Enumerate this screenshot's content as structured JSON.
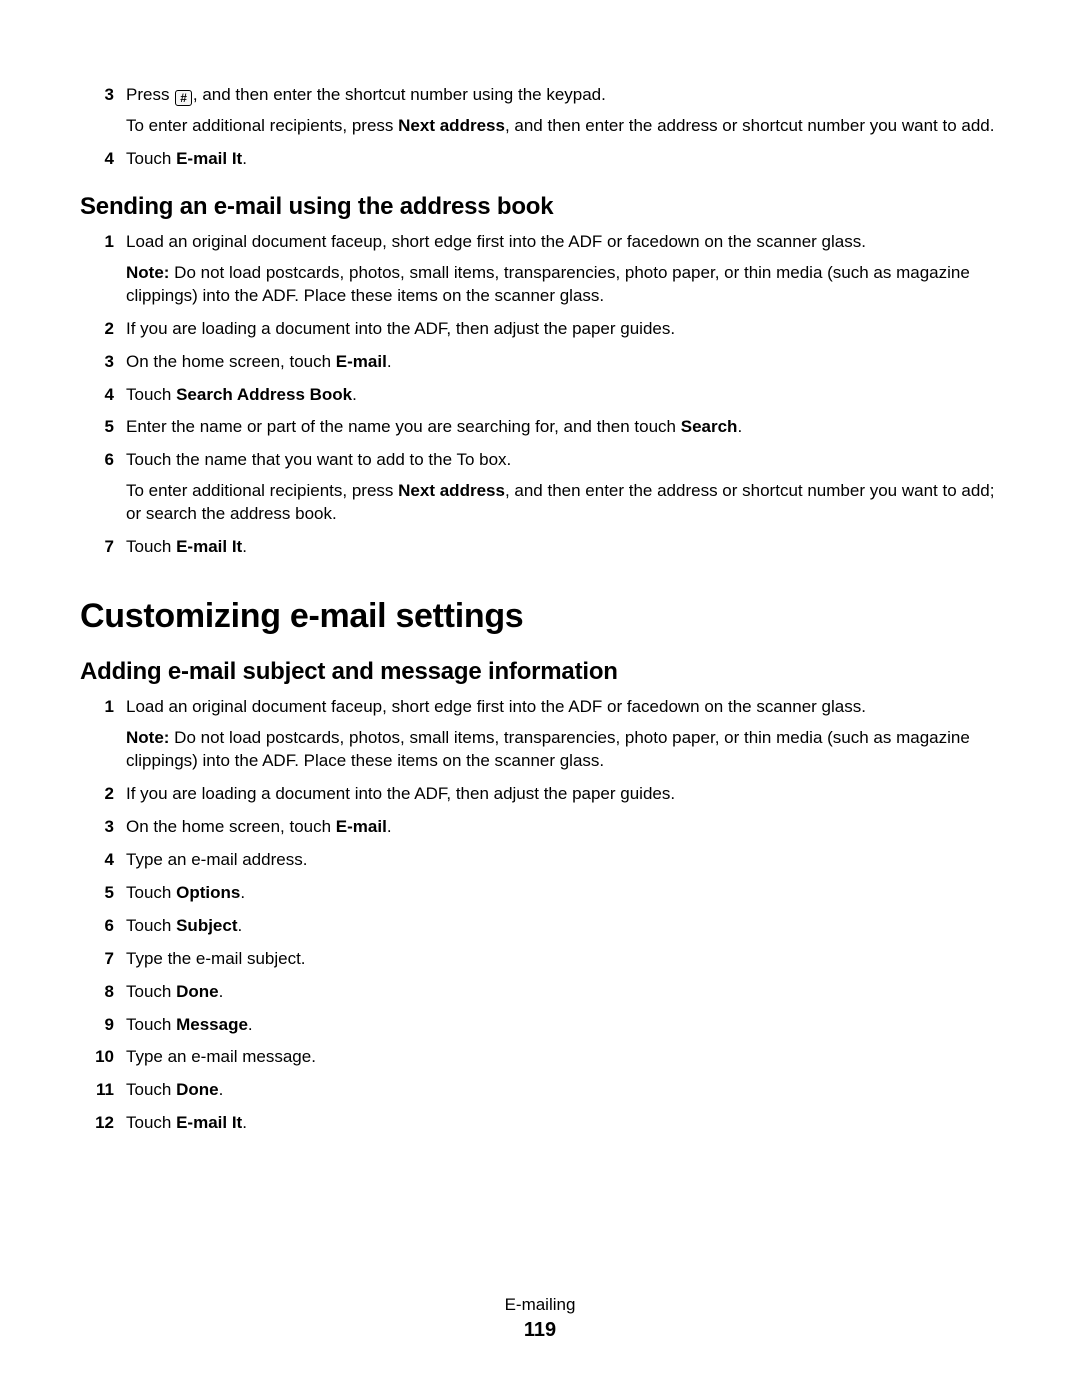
{
  "continuation_list": [
    {
      "num": "3",
      "paras": [
        {
          "runs": [
            {
              "t": "Press "
            },
            {
              "icon": "hash"
            },
            {
              "t": ", and then enter the shortcut number using the keypad."
            }
          ]
        },
        {
          "runs": [
            {
              "t": "To enter additional recipients, press "
            },
            {
              "t": "Next address",
              "bold": true
            },
            {
              "t": ", and then enter the address or shortcut number you want to add."
            }
          ]
        }
      ]
    },
    {
      "num": "4",
      "paras": [
        {
          "runs": [
            {
              "t": "Touch "
            },
            {
              "t": "E-mail It",
              "bold": true
            },
            {
              "t": "."
            }
          ]
        }
      ]
    }
  ],
  "subsection_a_title": "Sending an e-mail using the address book",
  "subsection_a_list": [
    {
      "num": "1",
      "paras": [
        {
          "runs": [
            {
              "t": "Load an original document faceup, short edge first into the ADF or facedown on the scanner glass."
            }
          ]
        },
        {
          "runs": [
            {
              "t": "Note: ",
              "bold": true
            },
            {
              "t": "Do not load postcards, photos, small items, transparencies, photo paper, or thin media (such as magazine clippings) into the ADF. Place these items on the scanner glass."
            }
          ]
        }
      ]
    },
    {
      "num": "2",
      "paras": [
        {
          "runs": [
            {
              "t": "If you are loading a document into the ADF, then adjust the paper guides."
            }
          ]
        }
      ]
    },
    {
      "num": "3",
      "paras": [
        {
          "runs": [
            {
              "t": "On the home screen, touch "
            },
            {
              "t": "E-mail",
              "bold": true
            },
            {
              "t": "."
            }
          ]
        }
      ]
    },
    {
      "num": "4",
      "paras": [
        {
          "runs": [
            {
              "t": "Touch "
            },
            {
              "t": "Search Address Book",
              "bold": true
            },
            {
              "t": "."
            }
          ]
        }
      ]
    },
    {
      "num": "5",
      "paras": [
        {
          "runs": [
            {
              "t": "Enter the name or part of the name you are searching for, and then touch "
            },
            {
              "t": "Search",
              "bold": true
            },
            {
              "t": "."
            }
          ]
        }
      ]
    },
    {
      "num": "6",
      "paras": [
        {
          "runs": [
            {
              "t": "Touch the name that you want to add to the To box."
            }
          ]
        },
        {
          "runs": [
            {
              "t": "To enter additional recipients, press "
            },
            {
              "t": "Next address",
              "bold": true
            },
            {
              "t": ", and then enter the address or shortcut number you want to add; or search the address book."
            }
          ]
        }
      ]
    },
    {
      "num": "7",
      "paras": [
        {
          "runs": [
            {
              "t": "Touch "
            },
            {
              "t": "E-mail It",
              "bold": true
            },
            {
              "t": "."
            }
          ]
        }
      ]
    }
  ],
  "section_title": "Customizing e-mail settings",
  "subsection_b_title": "Adding e-mail subject and message information",
  "subsection_b_list": [
    {
      "num": "1",
      "paras": [
        {
          "runs": [
            {
              "t": "Load an original document faceup, short edge first into the ADF or facedown on the scanner glass."
            }
          ]
        },
        {
          "runs": [
            {
              "t": "Note: ",
              "bold": true
            },
            {
              "t": "Do not load postcards, photos, small items, transparencies, photo paper, or thin media (such as magazine clippings) into the ADF. Place these items on the scanner glass."
            }
          ]
        }
      ]
    },
    {
      "num": "2",
      "paras": [
        {
          "runs": [
            {
              "t": "If you are loading a document into the ADF, then adjust the paper guides."
            }
          ]
        }
      ]
    },
    {
      "num": "3",
      "paras": [
        {
          "runs": [
            {
              "t": "On the home screen, touch "
            },
            {
              "t": "E-mail",
              "bold": true
            },
            {
              "t": "."
            }
          ]
        }
      ]
    },
    {
      "num": "4",
      "paras": [
        {
          "runs": [
            {
              "t": "Type an e-mail address."
            }
          ]
        }
      ]
    },
    {
      "num": "5",
      "paras": [
        {
          "runs": [
            {
              "t": "Touch "
            },
            {
              "t": "Options",
              "bold": true
            },
            {
              "t": "."
            }
          ]
        }
      ]
    },
    {
      "num": "6",
      "paras": [
        {
          "runs": [
            {
              "t": "Touch "
            },
            {
              "t": "Subject",
              "bold": true
            },
            {
              "t": "."
            }
          ]
        }
      ]
    },
    {
      "num": "7",
      "paras": [
        {
          "runs": [
            {
              "t": "Type the e-mail subject."
            }
          ]
        }
      ]
    },
    {
      "num": "8",
      "paras": [
        {
          "runs": [
            {
              "t": "Touch "
            },
            {
              "t": "Done",
              "bold": true
            },
            {
              "t": "."
            }
          ]
        }
      ]
    },
    {
      "num": "9",
      "paras": [
        {
          "runs": [
            {
              "t": "Touch "
            },
            {
              "t": "Message",
              "bold": true
            },
            {
              "t": "."
            }
          ]
        }
      ]
    },
    {
      "num": "10",
      "paras": [
        {
          "runs": [
            {
              "t": "Type an e-mail message."
            }
          ]
        }
      ]
    },
    {
      "num": "11",
      "paras": [
        {
          "runs": [
            {
              "t": "Touch "
            },
            {
              "t": "Done",
              "bold": true
            },
            {
              "t": "."
            }
          ]
        }
      ]
    },
    {
      "num": "12",
      "paras": [
        {
          "runs": [
            {
              "t": "Touch "
            },
            {
              "t": "E-mail It",
              "bold": true
            },
            {
              "t": "."
            }
          ]
        }
      ]
    }
  ],
  "footer": {
    "chapter": "E-mailing",
    "page": "119"
  },
  "icons": {
    "hash": "#"
  }
}
